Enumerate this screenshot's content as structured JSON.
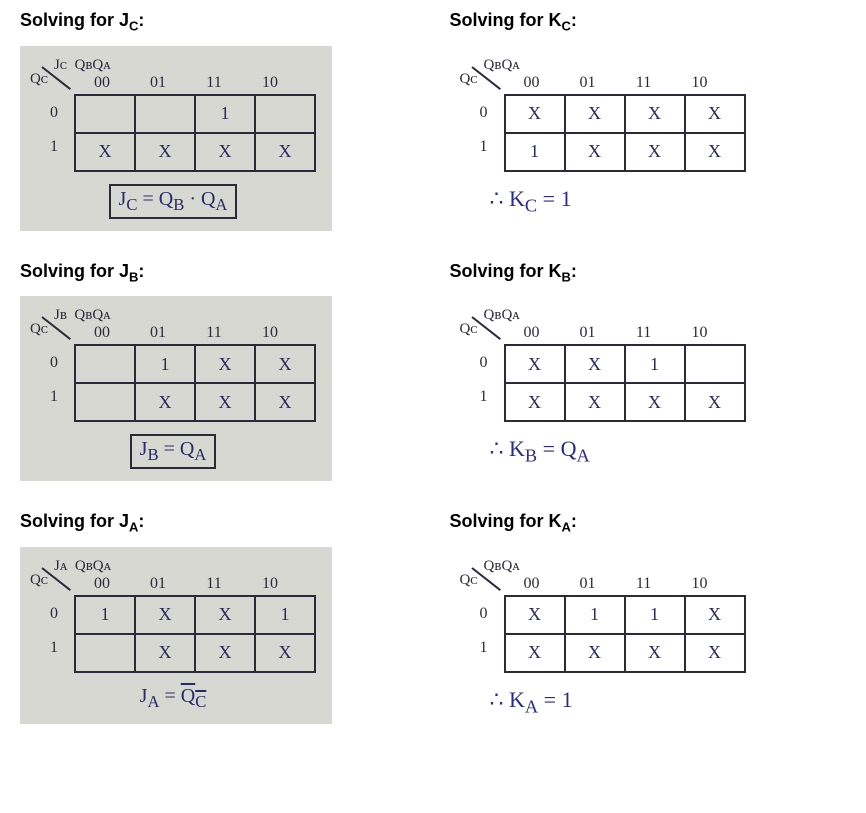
{
  "headings": {
    "jc": "Solving for J",
    "jc_sub": "C",
    "kc": "Solving for K",
    "kc_sub": "C",
    "jb": "Solving for J",
    "jb_sub": "B",
    "kb": "Solving for K",
    "kb_sub": "B",
    "ja": "Solving for J",
    "ja_sub": "A",
    "ka": "Solving for K",
    "ka_sub": "A",
    "colon": ":"
  },
  "col_headers": [
    "00",
    "01",
    "11",
    "10"
  ],
  "row_headers": [
    "0",
    "1"
  ],
  "axis_top": "QʙQᴀ",
  "axis_side": "Qᴄ",
  "kmaps": {
    "jc": {
      "var": "Jᴄ",
      "cells": [
        [
          "",
          "",
          "1",
          ""
        ],
        [
          "X",
          "X",
          "X",
          "X"
        ]
      ],
      "result_html": "J<sub>C</sub> = Q<sub>B</sub> · Q<sub>A</sub>",
      "boxed": true
    },
    "kc": {
      "var": "Kᴄ",
      "cells": [
        [
          "X",
          "X",
          "X",
          "X"
        ],
        [
          "1",
          "X",
          "X",
          "X"
        ]
      ],
      "result_html": "∴  K<sub>C</sub> = 1",
      "boxed": false
    },
    "jb": {
      "var": "Jʙ",
      "cells": [
        [
          "",
          "1",
          "X",
          "X"
        ],
        [
          "",
          "X",
          "X",
          "X"
        ]
      ],
      "result_html": "J<sub>B</sub> = Q<sub>A</sub>",
      "boxed": true
    },
    "kb": {
      "var": "Kʙ",
      "cells": [
        [
          "X",
          "X",
          "1",
          ""
        ],
        [
          "X",
          "X",
          "X",
          "X"
        ]
      ],
      "result_html": "∴  K<sub>B</sub> = Q<sub>A</sub>",
      "boxed": false
    },
    "ja": {
      "var": "Jᴀ",
      "cells": [
        [
          "1",
          "X",
          "X",
          "1"
        ],
        [
          "",
          "X",
          "X",
          "X"
        ]
      ],
      "result_html": "J<sub>A</sub> = <span class=\"overline\">Q<sub>C</sub></span>",
      "boxed": false,
      "result_prefix": ""
    },
    "ka": {
      "var": "Kᴀ",
      "cells": [
        [
          "X",
          "1",
          "1",
          "X"
        ],
        [
          "X",
          "X",
          "X",
          "X"
        ]
      ],
      "result_html": "∴  K<sub>A</sub> = 1",
      "boxed": false
    }
  }
}
